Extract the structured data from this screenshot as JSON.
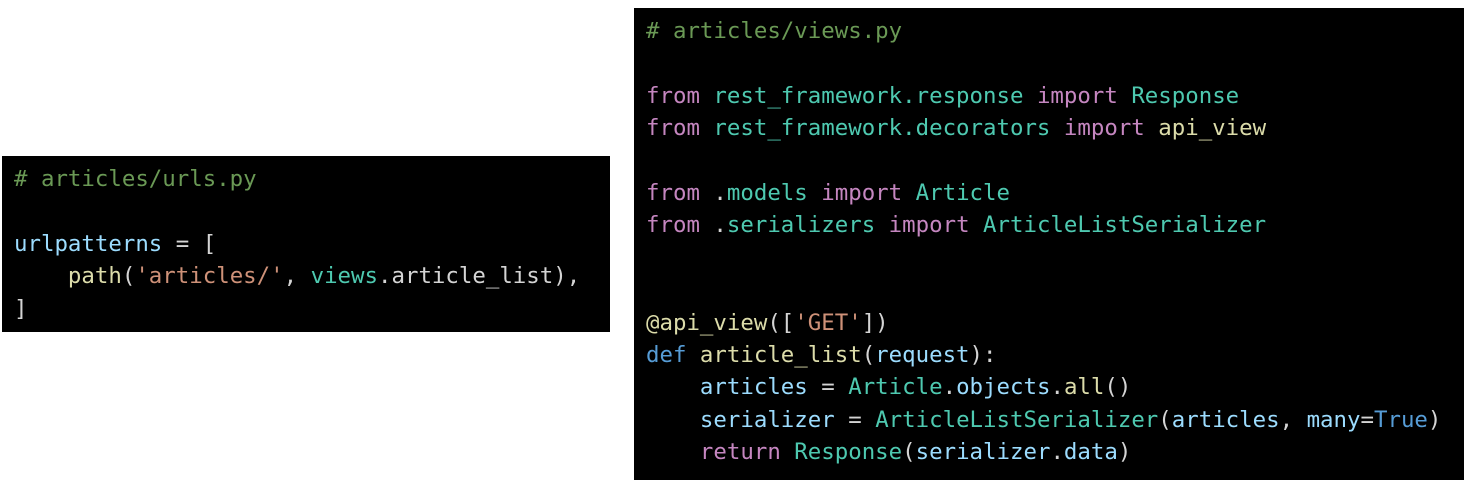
{
  "colors": {
    "c": "#6a9955",
    "k": "#c586c0",
    "t": "#4ec9b0",
    "f": "#dcdcaa",
    "v": "#9cdcfe",
    "s": "#ce9178",
    "b": "#569cd6",
    "p": "#d4d4d4",
    "background": "#000000"
  },
  "urls_code": {
    "lines": [
      [
        [
          "# articles/urls.py",
          "c"
        ]
      ],
      [],
      [
        [
          "urlpatterns",
          "v"
        ],
        [
          " = [",
          "p"
        ]
      ],
      [
        [
          "    ",
          "p"
        ],
        [
          "path",
          "f"
        ],
        [
          "(",
          "p"
        ],
        [
          "'articles/'",
          "s"
        ],
        [
          ", ",
          "p"
        ],
        [
          "views",
          "t"
        ],
        [
          ".article_list),",
          "p"
        ]
      ],
      [
        [
          "]",
          "p"
        ]
      ]
    ]
  },
  "views_code": {
    "lines": [
      [
        [
          "# articles/views.py",
          "c"
        ]
      ],
      [],
      [
        [
          "from ",
          "k"
        ],
        [
          "rest_framework.response",
          "t"
        ],
        [
          " import ",
          "k"
        ],
        [
          "Response",
          "t"
        ]
      ],
      [
        [
          "from ",
          "k"
        ],
        [
          "rest_framework.decorators",
          "t"
        ],
        [
          " import ",
          "k"
        ],
        [
          "api_view",
          "f"
        ]
      ],
      [],
      [
        [
          "from ",
          "k"
        ],
        [
          ".",
          "p"
        ],
        [
          "models",
          "t"
        ],
        [
          " import ",
          "k"
        ],
        [
          "Article",
          "t"
        ]
      ],
      [
        [
          "from ",
          "k"
        ],
        [
          ".",
          "p"
        ],
        [
          "serializers",
          "t"
        ],
        [
          " import ",
          "k"
        ],
        [
          "ArticleListSerializer",
          "t"
        ]
      ],
      [],
      [],
      [
        [
          "@api_view",
          "f"
        ],
        [
          "([",
          "p"
        ],
        [
          "'GET'",
          "s"
        ],
        [
          "])",
          "p"
        ]
      ],
      [
        [
          "def ",
          "b"
        ],
        [
          "article_list",
          "f"
        ],
        [
          "(",
          "p"
        ],
        [
          "request",
          "v"
        ],
        [
          "):",
          "p"
        ]
      ],
      [
        [
          "    ",
          "p"
        ],
        [
          "articles",
          "v"
        ],
        [
          " = ",
          "p"
        ],
        [
          "Article",
          "t"
        ],
        [
          ".",
          "p"
        ],
        [
          "objects",
          "v"
        ],
        [
          ".",
          "p"
        ],
        [
          "all",
          "f"
        ],
        [
          "()",
          "p"
        ]
      ],
      [
        [
          "    ",
          "p"
        ],
        [
          "serializer",
          "v"
        ],
        [
          " = ",
          "p"
        ],
        [
          "ArticleListSerializer",
          "t"
        ],
        [
          "(",
          "p"
        ],
        [
          "articles",
          "v"
        ],
        [
          ", ",
          "p"
        ],
        [
          "many",
          "v"
        ],
        [
          "=",
          "p"
        ],
        [
          "True",
          "b"
        ],
        [
          ")",
          "p"
        ]
      ],
      [
        [
          "    ",
          "p"
        ],
        [
          "return ",
          "k"
        ],
        [
          "Response",
          "t"
        ],
        [
          "(",
          "p"
        ],
        [
          "serializer",
          "v"
        ],
        [
          ".",
          "p"
        ],
        [
          "data",
          "v"
        ],
        [
          ")",
          "p"
        ]
      ]
    ]
  }
}
